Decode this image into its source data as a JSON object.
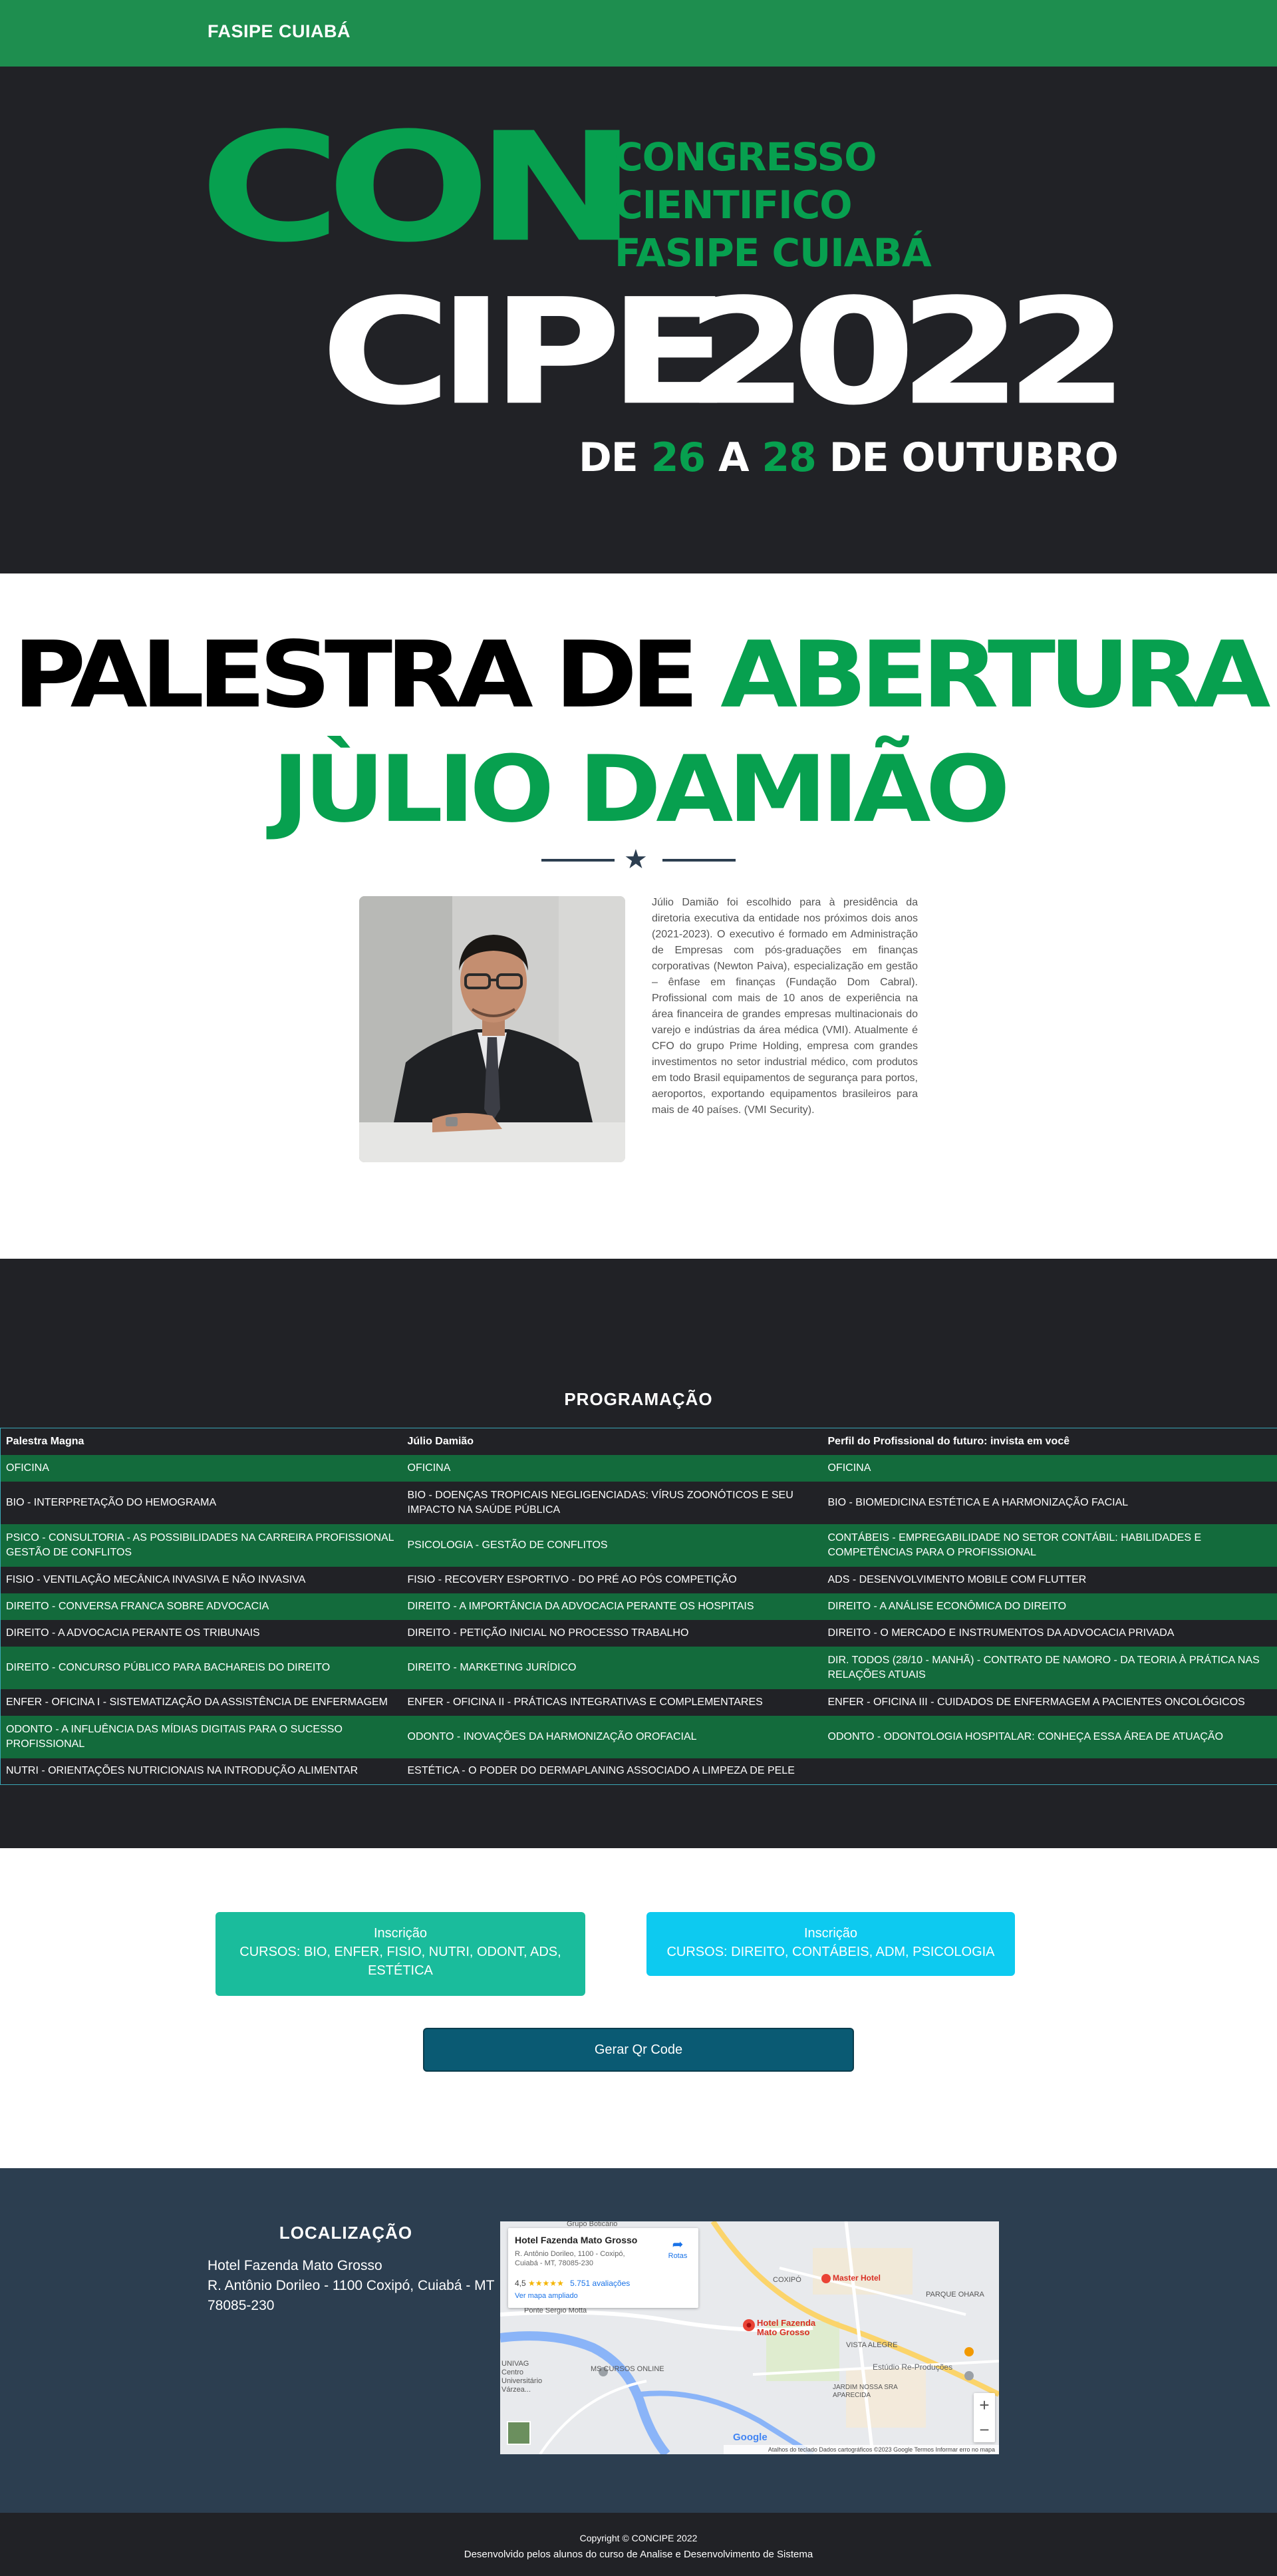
{
  "nav": {
    "brand": "FASIPE CUIABÁ"
  },
  "hero": {
    "con": "CON",
    "congress_lines": [
      "CONGRESSO",
      "CIENTIFICO",
      "FASIPE CUIABÁ"
    ],
    "cipe": "CIPE",
    "year": "2022",
    "dates": {
      "de": "DE",
      "start": "26",
      "a": "A",
      "end": "28",
      "month": "DE OUTUBRO"
    }
  },
  "speaker": {
    "title_part1": "PALESTRA DE",
    "title_part2": "ABERTURA",
    "name": "JÙLIO DAMIÃO",
    "photo_alt": "Júlio Damião",
    "bio": "Júlio Damião foi escolhido para à presidência da diretoria executiva da entidade nos próximos dois anos (2021-2023). O executivo é formado em Administração de Empresas com pós-graduações em finanças corporativas (Newton Paiva), especialização em gestão – ênfase em finanças (Fundação Dom Cabral). Profissional com mais de 10 anos de experiência na área financeira de grandes empresas multinacionais do varejo e indústrias da área médica (VMI). Atualmente é CFO do grupo Prime Holding, empresa com grandes investimentos no setor industrial médico, com produtos em todo Brasil equipamentos de segurança para portos, aeroportos, exportando equipamentos brasileiros para mais de 40 países. (VMI Security).",
    "divider_icon": "star-icon"
  },
  "schedule": {
    "title": "PROGRAMAÇÃO",
    "headers": [
      "Palestra Magna",
      "Júlio Damião",
      "Perfil do Profissional do futuro: invista em você"
    ],
    "rows": [
      [
        "OFICINA",
        "OFICINA",
        "OFICINA"
      ],
      [
        "BIO - INTERPRETAÇÃO DO HEMOGRAMA",
        "BIO - DOENÇAS TROPICAIS NEGLIGENCIADAS: VÍRUS ZOONÓTICOS E SEU IMPACTO NA SAÚDE PÚBLICA",
        "BIO - BIOMEDICINA ESTÉTICA E A HARMONIZAÇÃO FACIAL"
      ],
      [
        "PSICO - CONSULTORIA - AS POSSIBILIDADES NA CARREIRA PROFISSIONAL GESTÃO DE CONFLITOS",
        "PSICOLOGIA - GESTÃO DE CONFLITOS",
        "CONTÁBEIS - EMPREGABILIDADE NO SETOR CONTÁBIL: HABILIDADES E COMPETÊNCIAS PARA O PROFISSIONAL"
      ],
      [
        "FISIO - VENTILAÇÃO MECÂNICA INVASIVA E NÃO INVASIVA",
        "FISIO - RECOVERY ESPORTIVO - DO PRÉ AO PÓS COMPETIÇÃO",
        "ADS - DESENVOLVIMENTO MOBILE COM FLUTTER"
      ],
      [
        "DIREITO - CONVERSA FRANCA SOBRE ADVOCACIA",
        "DIREITO - A IMPORTÂNCIA DA ADVOCACIA PERANTE OS HOSPITAIS",
        "DIREITO - A ANÁLISE ECONÔMICA DO DIREITO"
      ],
      [
        "DIREITO - A ADVOCACIA PERANTE OS TRIBUNAIS",
        "DIREITO - PETIÇÃO INICIAL NO PROCESSO TRABALHO",
        "DIREITO - O MERCADO E INSTRUMENTOS DA ADVOCACIA PRIVADA"
      ],
      [
        "DIREITO - CONCURSO PÚBLICO PARA BACHAREIS DO DIREITO",
        "DIREITO - MARKETING JURÍDICO",
        "DIR. TODOS (28/10 - MANHÃ) - CONTRATO DE NAMORO - DA TEORIA À PRÁTICA NAS RELAÇÕES ATUAIS"
      ],
      [
        "ENFER - OFICINA I - SISTEMATIZAÇÃO DA ASSISTÊNCIA DE ENFERMAGEM",
        "ENFER - OFICINA II - PRÁTICAS INTEGRATIVAS E COMPLEMENTARES",
        "ENFER - OFICINA III - CUIDADOS DE ENFERMAGEM A PACIENTES ONCOLÓGICOS"
      ],
      [
        "ODONTO - A INFLUÊNCIA DAS MÍDIAS DIGITAIS PARA O SUCESSO PROFISSIONAL",
        "ODONTO - INOVAÇÕES DA HARMONIZAÇÃO OROFACIAL",
        "ODONTO - ODONTOLOGIA HOSPITALAR: CONHEÇA ESSA ÁREA DE ATUAÇÃO"
      ],
      [
        "NUTRI - ORIENTAÇÕES NUTRICIONAIS NA INTRODUÇÃO ALIMENTAR",
        "ESTÉTICA - O PODER DO DERMAPLANING ASSOCIADO A LIMPEZA DE PELE",
        ""
      ]
    ]
  },
  "registration": {
    "btn_a_label": "Inscrição",
    "btn_a_courses": "CURSOS: BIO, ENFER, FISIO, NUTRI, ODONT, ADS, ESTÉTICA",
    "btn_b_label": "Inscrição",
    "btn_b_courses": "CURSOS: DIREITO, CONTÁBEIS, ADM, PSICOLOGIA",
    "qr_label": "Gerar Qr Code"
  },
  "location": {
    "title": "LOCALIZAÇÃO",
    "venue": "Hotel Fazenda Mato Grosso",
    "address": "R. Antônio Dorileo - 1100 Coxipó, Cuiabá - MT 78085-230",
    "map": {
      "card_title": "Hotel Fazenda Mato Grosso",
      "card_address": "R. Antônio Dorileo, 1100 - Coxipó, Cuiabá - MT, 78085-230",
      "rating": "4,5",
      "stars": "★★★★★",
      "reviews": "5.751 avaliações",
      "larger_map": "Ver mapa ampliado",
      "directions": "Rotas",
      "poi_hotel": "Hotel Fazenda Mato Grosso",
      "poi_master": "Master Hotel",
      "poi_studio": "Estúdio Re-Produções",
      "poi_ms": "MS CURSOS ONLINE",
      "lbl_coxipo": "COXIPÓ",
      "lbl_parque": "PARQUE OHARA",
      "lbl_ponte": "Ponte Sérgio Motta",
      "lbl_jardim": "JARDIM NOSSA SRA APARECIDA",
      "lbl_vista": "VISTA ALEGRE",
      "lbl_grupo": "Grupo Boticário",
      "lbl_univag": "UNIVAG Centro Universitário Várzea...",
      "google": "Google",
      "footer": "Atalhos do teclado   Dados cartográficos ©2023 Google   Termos   Informar erro no mapa",
      "zoom_in": "+",
      "zoom_out": "−"
    }
  },
  "footer": {
    "copyright": "Copyright © CONCIPE 2022",
    "credit": "Desenvolvido pelos alunos do curso de Analise e Desenvolvimento de Sistema"
  }
}
